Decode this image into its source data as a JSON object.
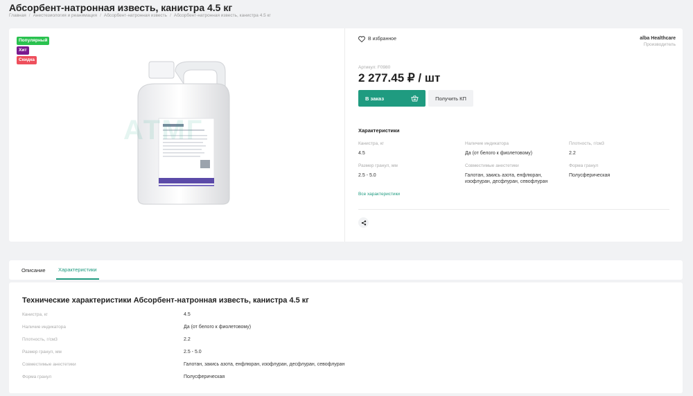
{
  "page": {
    "title": "Абсорбент-натронная известь, канистра 4.5 кг"
  },
  "breadcrumb": [
    "Главная",
    "Анестезиология и реанимация",
    "Абсорбент-натронная известь",
    "Абсорбент-натронная известь, канистра 4.5 кг"
  ],
  "badges": {
    "popular": "Популярный",
    "hit": "Хит",
    "sale": "Скидка"
  },
  "watermark": "АТМГ",
  "product": {
    "favorite_label": "В избранное",
    "manufacturer_name": "alba Healthcare",
    "manufacturer_role": "Производитель",
    "article": "Артикул: F0980",
    "price": "2 277.45 ₽ / шт",
    "order_label": "В заказ",
    "kp_label": "Получить КП"
  },
  "characteristics": {
    "title": "Характеристики",
    "items": [
      {
        "label": "Канистра, кг",
        "value": "4.5"
      },
      {
        "label": "Наличие индикатора",
        "value": "Да (от белого к фиолетовому)"
      },
      {
        "label": "Плотность, г/см3",
        "value": "2.2"
      },
      {
        "label": "Размер гранул, мм",
        "value": "2.5 - 5.0"
      },
      {
        "label": "Совместимые анестетики",
        "value": "Галотан, закись азота, енфлюран, изофлуран, десфлуран, севофлуран"
      },
      {
        "label": "Форма гранул",
        "value": "Полусферическая"
      }
    ],
    "all_link": "Все характеристики"
  },
  "tabs": [
    {
      "label": "Описание",
      "active": false
    },
    {
      "label": "Характеристики",
      "active": true
    }
  ],
  "specs": {
    "title": "Технические характеристики Абсорбент-натронная известь, канистра 4.5 кг",
    "rows": [
      {
        "label": "Канистра, кг",
        "value": "4.5"
      },
      {
        "label": "Наличие индикатора",
        "value": "Да (от белого к фиолетовому)"
      },
      {
        "label": "Плотность, г/см3",
        "value": "2.2"
      },
      {
        "label": "Размер гранул, мм",
        "value": "2.5 - 5.0"
      },
      {
        "label": "Совместимые анестетики",
        "value": "Галотан, закись азота, енфлюран, изофлуран, десфлуран, севофлуран"
      },
      {
        "label": "Форма гранул",
        "value": "Полусферическая"
      }
    ]
  },
  "colors": {
    "accent": "#1f9b80",
    "badge_popular": "#29c14e",
    "badge_hit": "#7a1a8f",
    "badge_sale": "#ee4f5c"
  },
  "icons": {
    "favorite": "heart-icon",
    "basket": "basket-icon",
    "share": "share-icon"
  }
}
